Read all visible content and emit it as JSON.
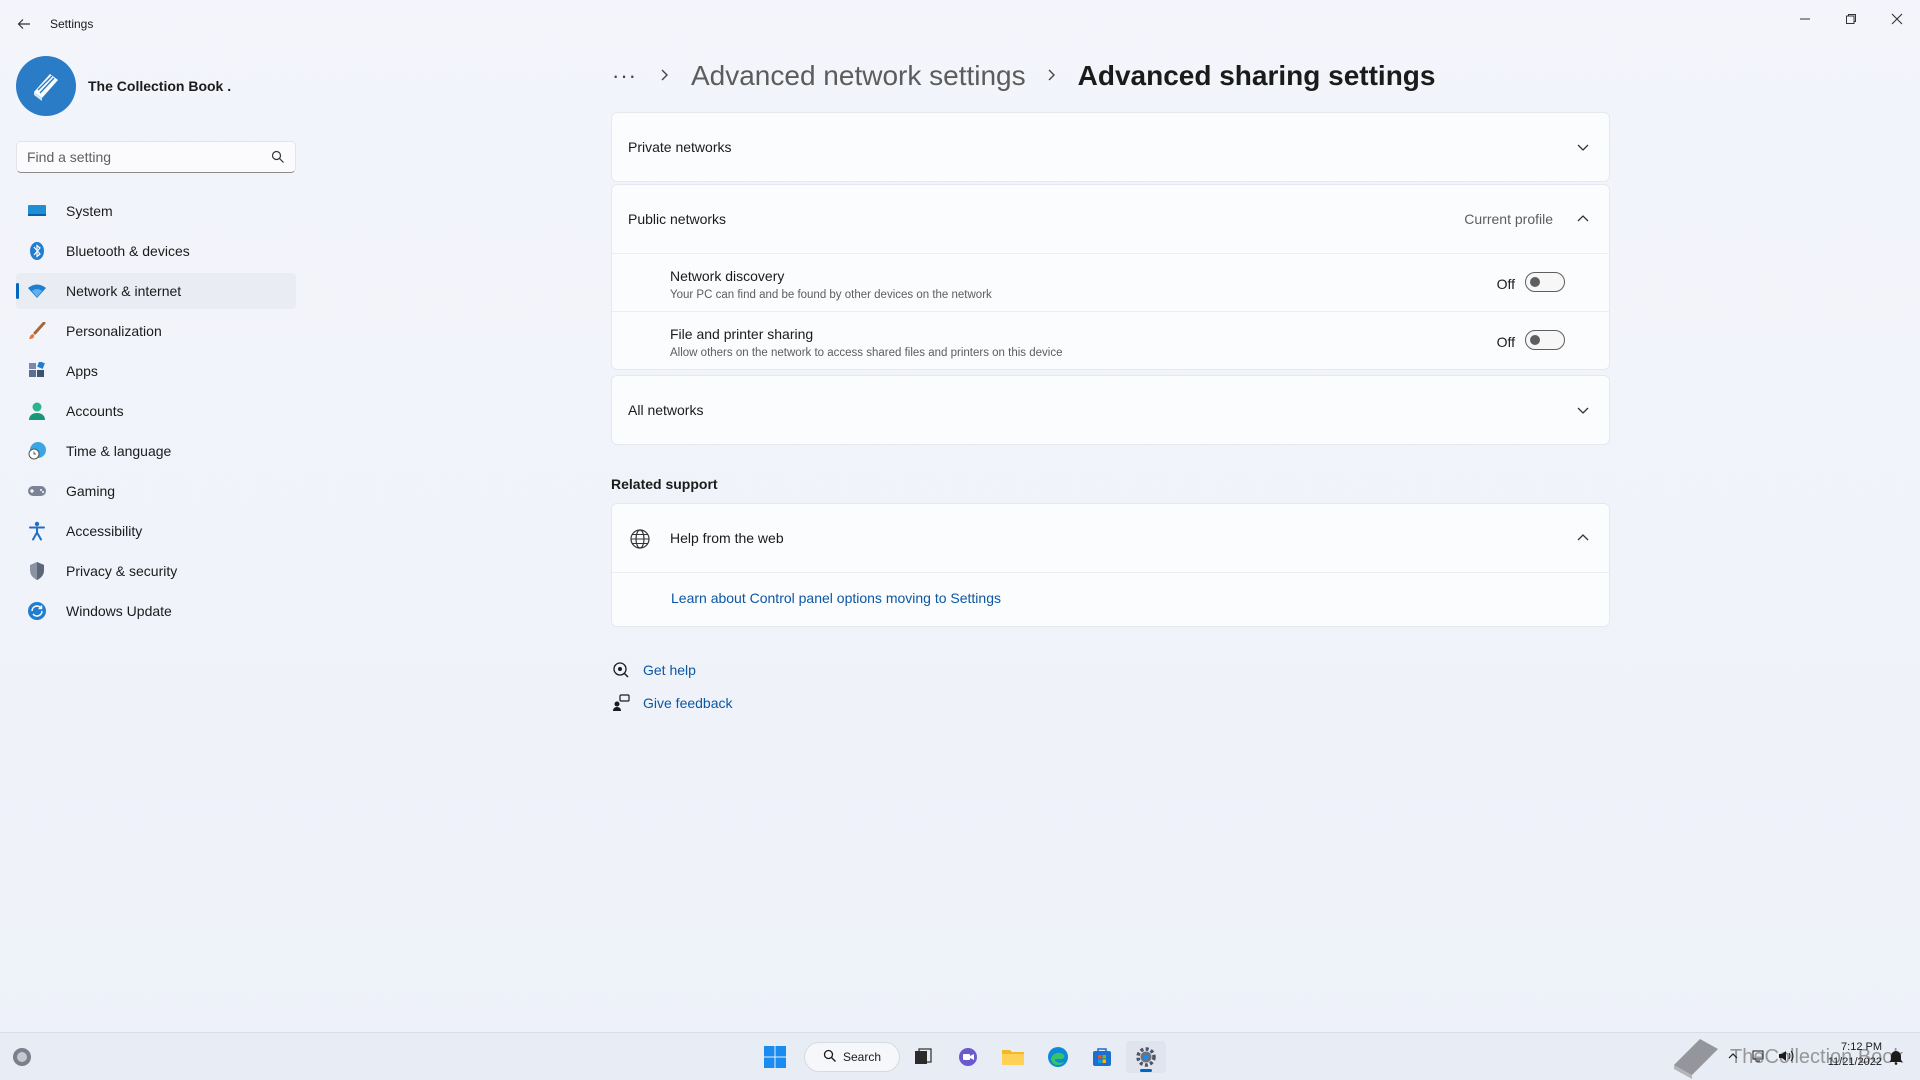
{
  "window": {
    "title": "Settings",
    "back_icon": "back-arrow-icon",
    "minimize_icon": "minimize-icon",
    "maximize_icon": "restore-icon",
    "close_icon": "close-icon"
  },
  "profile": {
    "name": "The Collection Book ."
  },
  "search": {
    "placeholder": "Find a setting"
  },
  "sidebar": {
    "items": [
      {
        "label": "System",
        "icon": "system-icon"
      },
      {
        "label": "Bluetooth & devices",
        "icon": "bluetooth-icon"
      },
      {
        "label": "Network & internet",
        "icon": "wifi-icon",
        "active": true
      },
      {
        "label": "Personalization",
        "icon": "brush-icon"
      },
      {
        "label": "Apps",
        "icon": "apps-icon"
      },
      {
        "label": "Accounts",
        "icon": "person-icon"
      },
      {
        "label": "Time & language",
        "icon": "globe-clock-icon"
      },
      {
        "label": "Gaming",
        "icon": "gamepad-icon"
      },
      {
        "label": "Accessibility",
        "icon": "accessibility-icon"
      },
      {
        "label": "Privacy & security",
        "icon": "shield-icon"
      },
      {
        "label": "Windows Update",
        "icon": "update-icon"
      }
    ]
  },
  "breadcrumb": {
    "more": "···",
    "parent": "Advanced network settings",
    "current": "Advanced sharing settings"
  },
  "sections": {
    "private": {
      "label": "Private networks"
    },
    "public": {
      "label": "Public networks",
      "badge": "Current profile",
      "settings": [
        {
          "title": "Network discovery",
          "desc": "Your PC can find and be found by other devices on the network",
          "state": "Off"
        },
        {
          "title": "File and printer sharing",
          "desc": "Allow others on the network to access shared files and printers on this device",
          "state": "Off"
        }
      ]
    },
    "all": {
      "label": "All networks"
    }
  },
  "related": {
    "title": "Related support",
    "help_web": "Help from the web",
    "link": "Learn about Control panel options moving to Settings"
  },
  "footer": {
    "get_help": "Get help",
    "give_feedback": "Give feedback"
  },
  "taskbar": {
    "search_label": "Search",
    "time": "7:12 PM",
    "date": "11/21/2022",
    "watermark": "TheCollection Book"
  },
  "colors": {
    "accent": "#0067c0",
    "link": "#0b57a4"
  }
}
